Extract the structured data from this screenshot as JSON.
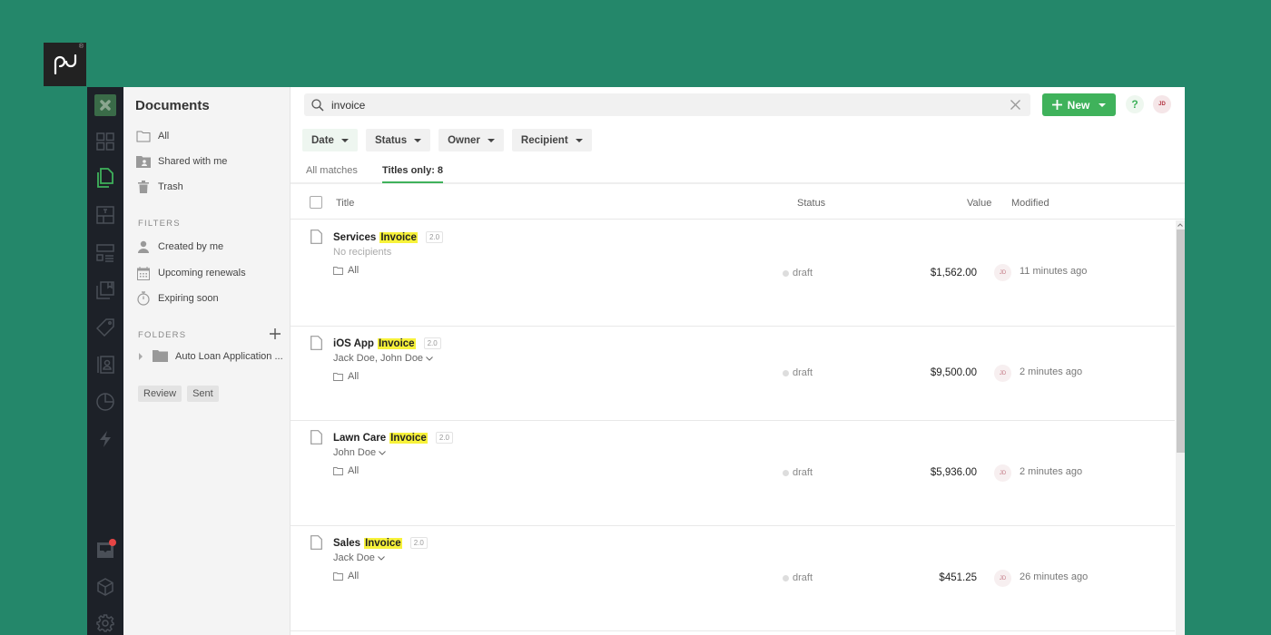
{
  "brand": {
    "logo_text": "pd",
    "registered": "®"
  },
  "rail": {
    "items": [
      {
        "name": "dashboard-icon",
        "active": false
      },
      {
        "name": "documents-icon",
        "active": true
      },
      {
        "name": "templates-icon",
        "active": false
      },
      {
        "name": "content-library-icon",
        "active": false
      },
      {
        "name": "catalog-icon",
        "active": false
      },
      {
        "name": "pricing-tag-icon",
        "active": false
      },
      {
        "name": "contacts-icon",
        "active": false
      },
      {
        "name": "reports-icon",
        "active": false
      },
      {
        "name": "automations-icon",
        "active": false
      }
    ],
    "bottom": [
      {
        "name": "inbox-icon",
        "has_notification": true
      },
      {
        "name": "integrations-cube-icon",
        "has_notification": false
      },
      {
        "name": "settings-gear-icon",
        "has_notification": false
      }
    ],
    "accent_color": "#3fb25b"
  },
  "side": {
    "title": "Documents",
    "nav": [
      {
        "label": "All",
        "icon": "folder-outline-icon"
      },
      {
        "label": "Shared with me",
        "icon": "shared-folder-icon"
      },
      {
        "label": "Trash",
        "icon": "trash-icon"
      }
    ],
    "filters_label": "FILTERS",
    "filters": [
      {
        "label": "Created by me",
        "icon": "person-icon"
      },
      {
        "label": "Upcoming renewals",
        "icon": "calendar-icon"
      },
      {
        "label": "Expiring soon",
        "icon": "stopwatch-icon"
      }
    ],
    "folders_label": "FOLDERS",
    "folders": [
      {
        "label": "Auto Loan Application ..."
      }
    ],
    "tags": [
      "Review",
      "Sent"
    ]
  },
  "search": {
    "value": "invoice",
    "placeholder": ""
  },
  "header": {
    "new_label": "New",
    "help_label": "?",
    "user_initials": "JD"
  },
  "filters": [
    {
      "label": "Date",
      "active": true
    },
    {
      "label": "Status",
      "active": false
    },
    {
      "label": "Owner",
      "active": false
    },
    {
      "label": "Recipient",
      "active": false
    }
  ],
  "tabs": [
    {
      "label": "All matches",
      "active": false
    },
    {
      "label": "Titles only: 8",
      "active": true
    }
  ],
  "table": {
    "columns": {
      "title": "Title",
      "status": "Status",
      "value": "Value",
      "modified": "Modified"
    },
    "rows": [
      {
        "title_prefix": "Services ",
        "title_match": "Invoice",
        "version": "2.0",
        "recipients": "No recipients",
        "recipients_muted": true,
        "folder": "All",
        "status": "draft",
        "value": "$1,562.00",
        "owner_initials": "JD",
        "modified": "11 minutes ago"
      },
      {
        "title_prefix": "iOS App ",
        "title_match": "Invoice",
        "version": "2.0",
        "recipients": "Jack Doe, John Doe",
        "recipients_muted": false,
        "folder": "All",
        "status": "draft",
        "value": "$9,500.00",
        "owner_initials": "JD",
        "modified": "2 minutes ago"
      },
      {
        "title_prefix": "Lawn Care ",
        "title_match": "Invoice",
        "version": "2.0",
        "recipients": "John Doe",
        "recipients_muted": false,
        "folder": "All",
        "status": "draft",
        "value": "$5,936.00",
        "owner_initials": "JD",
        "modified": "2 minutes ago"
      },
      {
        "title_prefix": "Sales ",
        "title_match": "Invoice",
        "version": "2.0",
        "recipients": "Jack Doe",
        "recipients_muted": false,
        "folder": "All",
        "status": "draft",
        "value": "$451.25",
        "owner_initials": "JD",
        "modified": "26 minutes ago"
      }
    ]
  }
}
